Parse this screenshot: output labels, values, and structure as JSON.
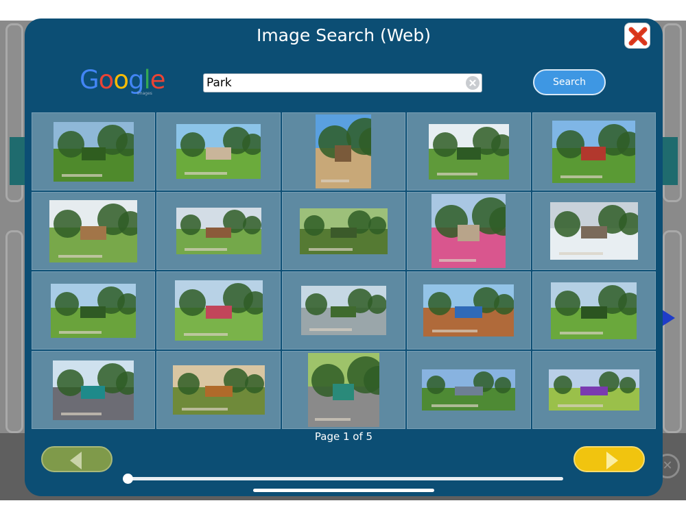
{
  "modal": {
    "title": "Image Search (Web)",
    "close_icon": "close-x-icon",
    "close_color": "#e03a1e"
  },
  "search": {
    "logo_text": "Google",
    "logo_subtext": "Images",
    "query": "Park",
    "clear_icon": "clear-circle-icon",
    "button_label": "Search"
  },
  "results": {
    "columns": 5,
    "rows": 4,
    "items": [
      {
        "name": "park-lawn-trees",
        "sky": "#8fb8d8",
        "ground": "#4f8a2c",
        "accent": "#2f5d1f"
      },
      {
        "name": "park-picnic-plaza",
        "sky": "#8cc4e8",
        "ground": "#6bab3c",
        "accent": "#c9b59a"
      },
      {
        "name": "playground-slide",
        "sky": "#5aa0e0",
        "ground": "#c8a878",
        "accent": "#7a5a3a"
      },
      {
        "name": "park-hedges",
        "sky": "#e7eef2",
        "ground": "#5f9a3a",
        "accent": "#2d5a24"
      },
      {
        "name": "red-playground",
        "sky": "#7fb6e6",
        "ground": "#5a9a34",
        "accent": "#b2382d"
      },
      {
        "name": "park-gazebo-play",
        "sky": "#e6ecef",
        "ground": "#78a84a",
        "accent": "#a27548"
      },
      {
        "name": "park-gazebo-path",
        "sky": "#d3dde6",
        "ground": "#74a84a",
        "accent": "#8b5a3a"
      },
      {
        "name": "shady-park-path",
        "sky": "#9dc07a",
        "ground": "#557a33",
        "accent": "#3b5a2a"
      },
      {
        "name": "flower-street",
        "sky": "#a9c7e3",
        "ground": "#d9568e",
        "accent": "#b8a48a"
      },
      {
        "name": "ice-rink-city",
        "sky": "#c9d2da",
        "ground": "#e8eef2",
        "accent": "#7a6a5a"
      },
      {
        "name": "park-meadow",
        "sky": "#a8cce6",
        "ground": "#6aa33c",
        "accent": "#2f5a24"
      },
      {
        "name": "autumn-trees-path",
        "sky": "#b8d2e6",
        "ground": "#7ab34a",
        "accent": "#c2455a"
      },
      {
        "name": "garden-fountain",
        "sky": "#c6d8e4",
        "ground": "#9aa6aa",
        "accent": "#3f6a2e"
      },
      {
        "name": "blue-playground",
        "sky": "#93c4e8",
        "ground": "#b06a3a",
        "accent": "#2f6ab8"
      },
      {
        "name": "park-path-trees",
        "sky": "#b5d0e4",
        "ground": "#6aa83c",
        "accent": "#2b5420"
      },
      {
        "name": "teal-playground",
        "sky": "#cfe1ee",
        "ground": "#6c6c74",
        "accent": "#1e8a8a"
      },
      {
        "name": "autumn-forest",
        "sky": "#d9c6a2",
        "ground": "#6f8a3a",
        "accent": "#b06a2a"
      },
      {
        "name": "girl-climbing",
        "sky": "#9ec36a",
        "ground": "#8a8a8a",
        "accent": "#2a8a7a"
      },
      {
        "name": "city-skyline-park",
        "sky": "#88b3e0",
        "ground": "#4e8a34",
        "accent": "#6d7f94"
      },
      {
        "name": "purple-playground",
        "sky": "#b9cfe8",
        "ground": "#9ac04a",
        "accent": "#7a3ab0"
      }
    ]
  },
  "pagination": {
    "label": "Page 1 of 5",
    "prev_icon": "arrow-left-icon",
    "next_icon": "arrow-right-icon",
    "prev_color": "#7f9a4a",
    "next_color": "#f1c40f"
  },
  "colors": {
    "modal_bg": "#0c4e74",
    "cell_bg": "#5e8aa2",
    "search_button": "#3e97e3"
  }
}
